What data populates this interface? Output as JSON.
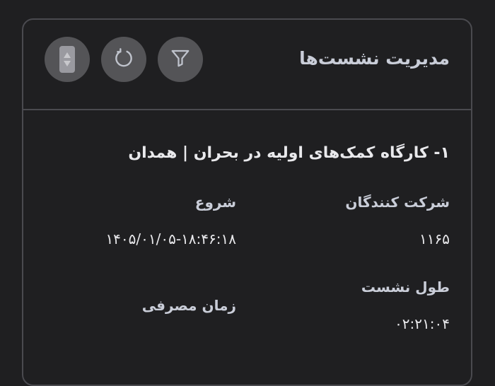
{
  "header": {
    "title": "مدیریت نشست‌ها",
    "buttons": [
      {
        "icon": "filter-icon"
      },
      {
        "icon": "refresh-icon"
      },
      {
        "icon": "sort-icon"
      }
    ]
  },
  "session": {
    "title": "۱- کارگاه کمک‌های اولیه در بحران | همدان",
    "participants_label": "شرکت کنندگان",
    "participants_value": "۱۱۶۵",
    "start_label": "شروع",
    "start_value": "۱۴۰۵/۰۱/۰۵-۱۸:۴۶:۱۸",
    "duration_label": "طول نشست",
    "duration_value": "۰۲:۲۱:۰۴",
    "time_used_label": "زمان مصرفی"
  },
  "colors": {
    "background": "#1f1f21",
    "border": "#4a4a4f",
    "button_bg": "#545457",
    "text_primary": "#e9e9ec",
    "text_secondary": "#c9cdd8"
  }
}
